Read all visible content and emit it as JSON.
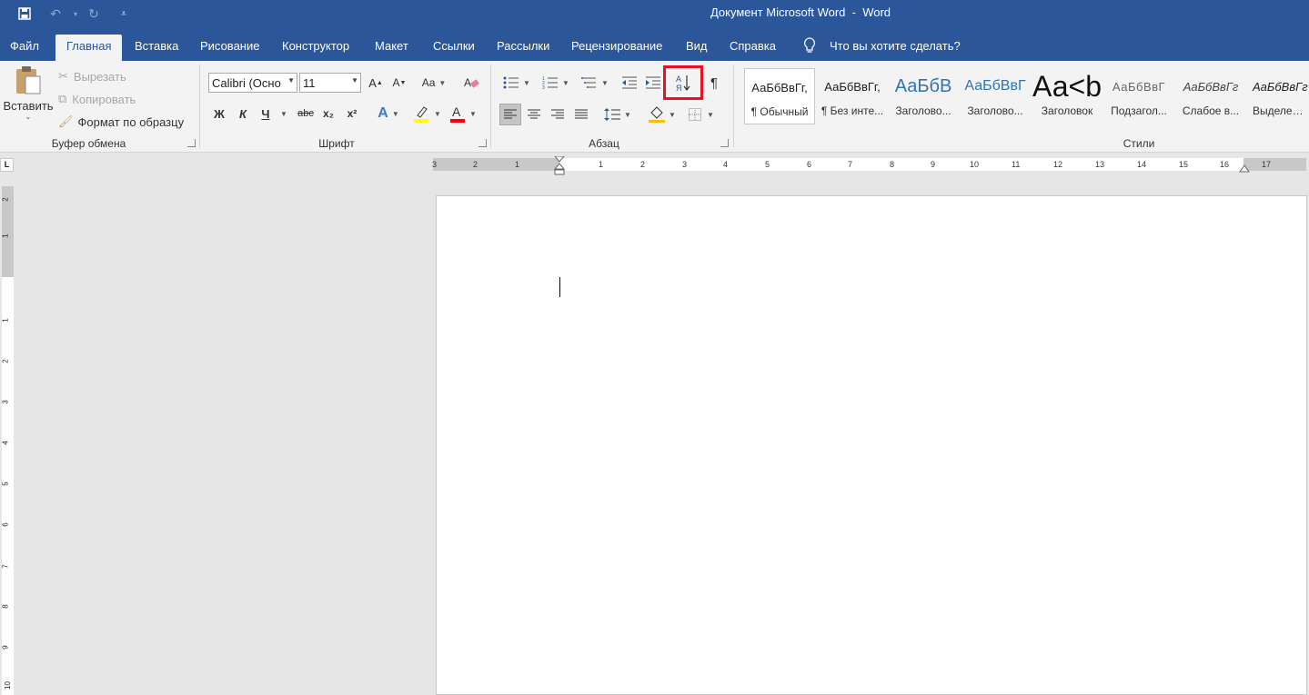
{
  "window": {
    "title": "Документ Microsoft Word  -  Word"
  },
  "tabs": [
    "Файл",
    "Главная",
    "Вставка",
    "Рисование",
    "Конструктор",
    "Макет",
    "Ссылки",
    "Рассылки",
    "Рецензирование",
    "Вид",
    "Справка"
  ],
  "tell_me": "Что вы хотите сделать?",
  "clipboard": {
    "group_label": "Буфер обмена",
    "paste": "Вставить",
    "cut": "Вырезать",
    "copy": "Копировать",
    "format_painter": "Формат по образцу"
  },
  "font": {
    "group_label": "Шрифт",
    "font_name": "Calibri (Осно",
    "font_size": "11",
    "bold": "Ж",
    "italic": "К",
    "underline": "Ч",
    "strike": "abc",
    "sub": "x₂",
    "sup": "x²",
    "grow": "A",
    "shrink": "A",
    "case": "Aa",
    "highlight_color": "#ffff00",
    "font_color": "#ff0000"
  },
  "paragraph": {
    "group_label": "Абзац",
    "sort_icon": "sort-az-icon",
    "pilcrow": "¶"
  },
  "styles": {
    "group_label": "Стили",
    "items": [
      {
        "preview": "АаБбВвГг,",
        "name": "¶ Обычный"
      },
      {
        "preview": "АаБбВвГг,",
        "name": "¶ Без инте..."
      },
      {
        "preview": "АаБбВ",
        "name": "Заголово..."
      },
      {
        "preview": "АаБбВвГ",
        "name": "Заголово..."
      },
      {
        "preview": "Аа<b",
        "name": "Заголовок"
      },
      {
        "preview": "АаБбВвГ",
        "name": "Подзагол..."
      },
      {
        "preview": "АаБбВвГг",
        "name": "Слабое в..."
      },
      {
        "preview": "АаБбВвГг",
        "name": "Выделение"
      }
    ]
  },
  "ruler": {
    "ticks": [
      "3",
      "2",
      "1",
      "1",
      "2",
      "3",
      "4",
      "5",
      "6",
      "7",
      "8",
      "9",
      "10",
      "11",
      "12",
      "13",
      "14",
      "15",
      "16",
      "17"
    ]
  },
  "vruler": {
    "ticks": [
      "2",
      "1",
      "1",
      "2",
      "3",
      "4",
      "5",
      "6",
      "7",
      "8",
      "9",
      "10"
    ]
  },
  "colors": {
    "accent": "#2b579a",
    "highlight_box": "#e81123"
  }
}
